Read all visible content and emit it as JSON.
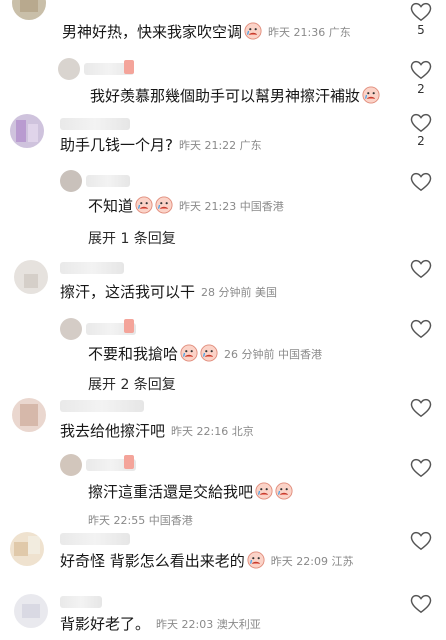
{
  "comments": [
    {
      "text": "男神好热，快来我家吹空调",
      "meta": "昨天 21:36 广东",
      "likes": "5"
    },
    {
      "text": "我好羡慕那幾個助手可以幫男神擦汗補妝",
      "meta": "",
      "likes": "2"
    },
    {
      "text": "助手几钱一个月?",
      "meta": "昨天 21:22 广东",
      "likes": "2"
    },
    {
      "text": "不知道",
      "meta": "昨天 21:23 中国香港",
      "likes": ""
    },
    {
      "text": "擦汗，这活我可以干",
      "meta": "28 分钟前 美国",
      "likes": ""
    },
    {
      "text": "不要和我搶哈",
      "meta": "26 分钟前 中国香港",
      "likes": ""
    },
    {
      "text": "我去给他擦汗吧",
      "meta": "昨天 22:16 北京",
      "likes": ""
    },
    {
      "text": "擦汗這重活還是交給我吧",
      "meta": "",
      "likes": ""
    },
    {
      "text": "",
      "meta": "昨天 22:55 中国香港",
      "likes": ""
    },
    {
      "text": "好奇怪 背影怎么看出来老的",
      "meta": "昨天 22:09 江苏",
      "likes": ""
    },
    {
      "text": "背影好老了。",
      "meta": "昨天 22:03 澳大利亚",
      "likes": ""
    }
  ],
  "expand": {
    "one": "展开 1 条回复",
    "two": "展开 2 条回复"
  },
  "icons": {
    "like": "heart-outline-icon",
    "emoji": "crying-face-icon"
  }
}
